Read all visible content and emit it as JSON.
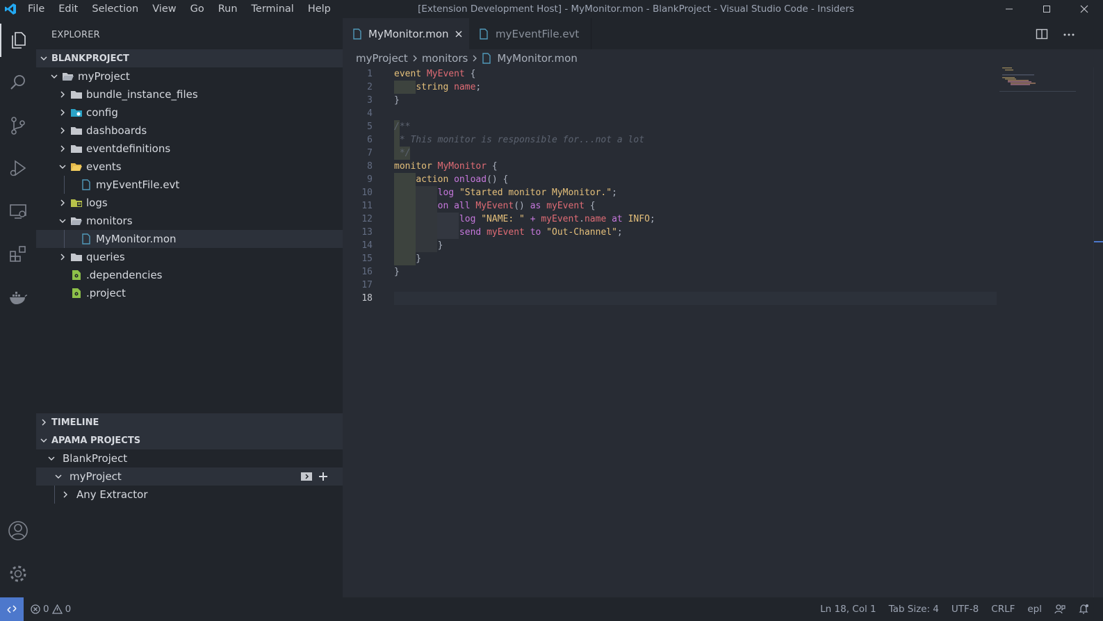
{
  "titlebar": {
    "menu": [
      "File",
      "Edit",
      "Selection",
      "View",
      "Go",
      "Run",
      "Terminal",
      "Help"
    ],
    "title": "[Extension Development Host] - MyMonitor.mon - BlankProject - Visual Studio Code - Insiders"
  },
  "activitybar": {
    "icons": [
      "files-icon",
      "search-icon",
      "source-control-icon",
      "run-debug-icon",
      "remote-explorer-icon",
      "extensions-icon",
      "docker-icon"
    ],
    "bottom_icons": [
      "account-icon",
      "settings-gear-icon"
    ]
  },
  "sidebar": {
    "title": "EXPLORER",
    "workspace": "BLANKPROJECT",
    "tree": [
      {
        "label": "myProject",
        "depth": 1,
        "kind": "folder-open",
        "expanded": true
      },
      {
        "label": "bundle_instance_files",
        "depth": 2,
        "kind": "folder",
        "expanded": false
      },
      {
        "label": "config",
        "depth": 2,
        "kind": "folder-config",
        "expanded": false
      },
      {
        "label": "dashboards",
        "depth": 2,
        "kind": "folder",
        "expanded": false
      },
      {
        "label": "eventdefinitions",
        "depth": 2,
        "kind": "folder",
        "expanded": false
      },
      {
        "label": "events",
        "depth": 2,
        "kind": "folder-events-open",
        "expanded": true
      },
      {
        "label": "myEventFile.evt",
        "depth": 3,
        "kind": "file"
      },
      {
        "label": "logs",
        "depth": 2,
        "kind": "folder-logs",
        "expanded": false
      },
      {
        "label": "monitors",
        "depth": 2,
        "kind": "folder-open",
        "expanded": true
      },
      {
        "label": "MyMonitor.mon",
        "depth": 3,
        "kind": "file",
        "selected": true
      },
      {
        "label": "queries",
        "depth": 2,
        "kind": "folder",
        "expanded": false
      },
      {
        "label": ".dependencies",
        "depth": 2,
        "kind": "file-green"
      },
      {
        "label": ".project",
        "depth": 2,
        "kind": "file-green"
      }
    ],
    "timeline": "TIMELINE",
    "apama": {
      "title": "APAMA PROJECTS",
      "project": "BlankProject",
      "child": "myProject",
      "grandchild": "Any Extractor"
    }
  },
  "editor": {
    "tabs": [
      {
        "label": "MyMonitor.mon",
        "active": true
      },
      {
        "label": "myEventFile.evt",
        "active": false
      }
    ],
    "breadcrumb": [
      "myProject",
      "monitors",
      "MyMonitor.mon"
    ],
    "line_numbers": [
      "1",
      "2",
      "3",
      "4",
      "5",
      "6",
      "7",
      "8",
      "9",
      "10",
      "11",
      "12",
      "13",
      "14",
      "15",
      "16",
      "17",
      "18"
    ]
  },
  "statusbar": {
    "errors": "0",
    "warnings": "0",
    "position": "Ln 18, Col 1",
    "tab_size": "Tab Size: 4",
    "encoding": "UTF-8",
    "eol": "CRLF",
    "language": "epl"
  },
  "colors": {
    "accent": "#4d78cc",
    "keyword": "#e5c07b",
    "type": "#e06c75",
    "function": "#c678dd",
    "comment": "#5c6370"
  }
}
